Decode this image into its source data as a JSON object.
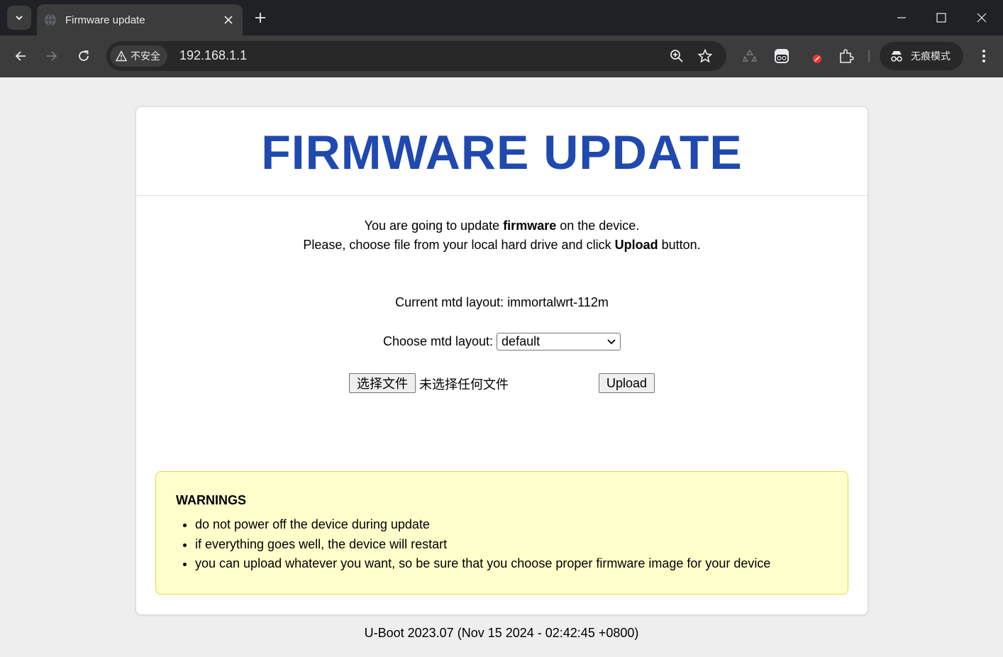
{
  "browser": {
    "tab": {
      "title": "Firmware update"
    },
    "address_bar": {
      "security_label": "不安全",
      "url": "192.168.1.1"
    },
    "incognito_label": "无痕模式",
    "icons": [
      "tab-search-icon",
      "globe-icon",
      "close-icon",
      "plus-icon",
      "minimize-icon",
      "maximize-icon",
      "close-window-icon",
      "back-icon",
      "forward-icon",
      "reload-icon",
      "warning-icon",
      "zoom-icon",
      "star-icon",
      "recycle-icon",
      "extension-face-icon",
      "blocker-icon",
      "puzzle-icon",
      "incognito-icon",
      "more-vert-icon"
    ]
  },
  "page": {
    "title": "FIRMWARE UPDATE",
    "intro": {
      "line1_pre": "You are going to update ",
      "line1_bold": "firmware",
      "line1_post": " on the device.",
      "line2_pre": "Please, choose file from your local hard drive and click ",
      "line2_bold": "Upload",
      "line2_post": " button."
    },
    "mtd_current_label": "Current mtd layout:",
    "mtd_current_value": "immortalwrt-112m",
    "mtd_choose_label": "Choose mtd layout:",
    "mtd_selected": "default",
    "file": {
      "button_label": "选择文件",
      "status": "未选择任何文件"
    },
    "upload_label": "Upload",
    "warnings": {
      "title": "WARNINGS",
      "items": [
        "do not power off the device during update",
        "if everything goes well, the device will restart",
        "you can upload whatever you want, so be sure that you choose proper firmware image for your device"
      ]
    },
    "footer": "U-Boot 2023.07 (Nov 15 2024 - 02:42:45 +0800)"
  },
  "colors": {
    "title_blue": "#2049b0",
    "warning_bg": "#ffffcc",
    "warning_border": "#e6d84a",
    "page_bg": "#eeeeee",
    "chrome_dark": "#202124"
  }
}
